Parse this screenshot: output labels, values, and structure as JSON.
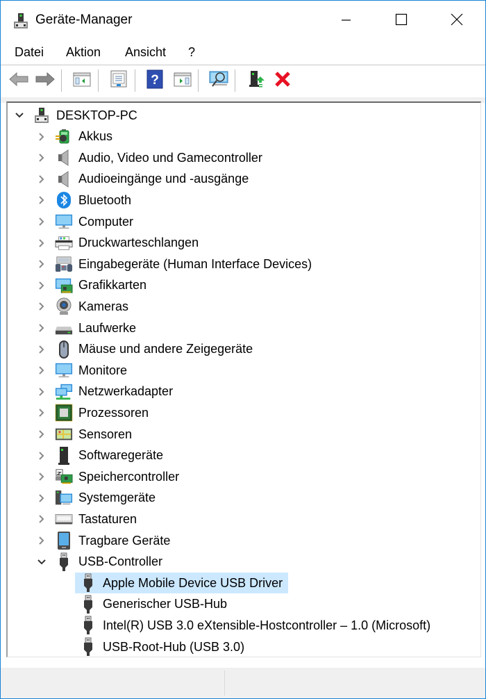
{
  "window": {
    "title": "Geräte-Manager",
    "title_icon": "device-manager-icon",
    "controls": {
      "minimize": "minimize",
      "maximize": "maximize",
      "close": "close"
    }
  },
  "menu": {
    "items": [
      {
        "label": "Datei"
      },
      {
        "label": "Aktion"
      },
      {
        "label": "Ansicht"
      },
      {
        "label": "?"
      }
    ]
  },
  "toolbar": {
    "buttons": [
      {
        "name": "back",
        "icon": "arrow-left-icon"
      },
      {
        "name": "forward",
        "icon": "arrow-right-icon"
      },
      {
        "name": "show-hide-console-tree",
        "icon": "console-tree-icon"
      },
      {
        "name": "properties",
        "icon": "properties-icon"
      },
      {
        "name": "help",
        "icon": "help-icon"
      },
      {
        "name": "show-hide-action-pane",
        "icon": "action-pane-icon"
      },
      {
        "name": "scan-hardware",
        "icon": "scan-hardware-icon"
      },
      {
        "name": "update-driver",
        "icon": "update-driver-icon"
      },
      {
        "name": "uninstall-device",
        "icon": "uninstall-icon"
      }
    ]
  },
  "tree": {
    "root": {
      "label": "DESKTOP-PC",
      "expanded": true,
      "icon": "computer-tower-icon"
    },
    "categories": [
      {
        "label": "Akkus",
        "icon": "battery-icon",
        "expanded": false
      },
      {
        "label": "Audio, Video und Gamecontroller",
        "icon": "speaker-icon",
        "expanded": false
      },
      {
        "label": "Audioeingänge und -ausgänge",
        "icon": "speaker-icon",
        "expanded": false
      },
      {
        "label": "Bluetooth",
        "icon": "bluetooth-icon",
        "expanded": false
      },
      {
        "label": "Computer",
        "icon": "monitor-icon",
        "expanded": false
      },
      {
        "label": "Druckwarteschlangen",
        "icon": "printer-icon",
        "expanded": false
      },
      {
        "label": "Eingabegeräte (Human Interface Devices)",
        "icon": "hid-icon",
        "expanded": false
      },
      {
        "label": "Grafikkarten",
        "icon": "graphics-card-icon",
        "expanded": false
      },
      {
        "label": "Kameras",
        "icon": "webcam-icon",
        "expanded": false
      },
      {
        "label": "Laufwerke",
        "icon": "disk-drive-icon",
        "expanded": false
      },
      {
        "label": "Mäuse und andere Zeigegeräte",
        "icon": "mouse-icon",
        "expanded": false
      },
      {
        "label": "Monitore",
        "icon": "monitor-icon",
        "expanded": false
      },
      {
        "label": "Netzwerkadapter",
        "icon": "network-icon",
        "expanded": false
      },
      {
        "label": "Prozessoren",
        "icon": "processor-icon",
        "expanded": false
      },
      {
        "label": "Sensoren",
        "icon": "sensor-icon",
        "expanded": false
      },
      {
        "label": "Softwaregeräte",
        "icon": "software-device-icon",
        "expanded": false
      },
      {
        "label": "Speichercontroller",
        "icon": "storage-controller-icon",
        "expanded": false
      },
      {
        "label": "Systemgeräte",
        "icon": "system-device-icon",
        "expanded": false
      },
      {
        "label": "Tastaturen",
        "icon": "keyboard-icon",
        "expanded": false
      },
      {
        "label": "Tragbare Geräte",
        "icon": "portable-device-icon",
        "expanded": false
      },
      {
        "label": "USB-Controller",
        "icon": "usb-icon",
        "expanded": true
      }
    ],
    "usb_children": [
      {
        "label": "Apple Mobile Device USB Driver",
        "icon": "usb-icon",
        "selected": true
      },
      {
        "label": "Generischer USB-Hub",
        "icon": "usb-icon",
        "selected": false
      },
      {
        "label": "Intel(R) USB 3.0 eXtensible-Hostcontroller – 1.0 (Microsoft)",
        "icon": "usb-icon",
        "selected": false
      },
      {
        "label": "USB-Root-Hub (USB 3.0)",
        "icon": "usb-icon",
        "selected": false
      }
    ]
  },
  "colors": {
    "window_border": "#1883d7",
    "selection": "#cce8ff",
    "uninstall_red": "#e81123",
    "update_green": "#2fb34a"
  }
}
